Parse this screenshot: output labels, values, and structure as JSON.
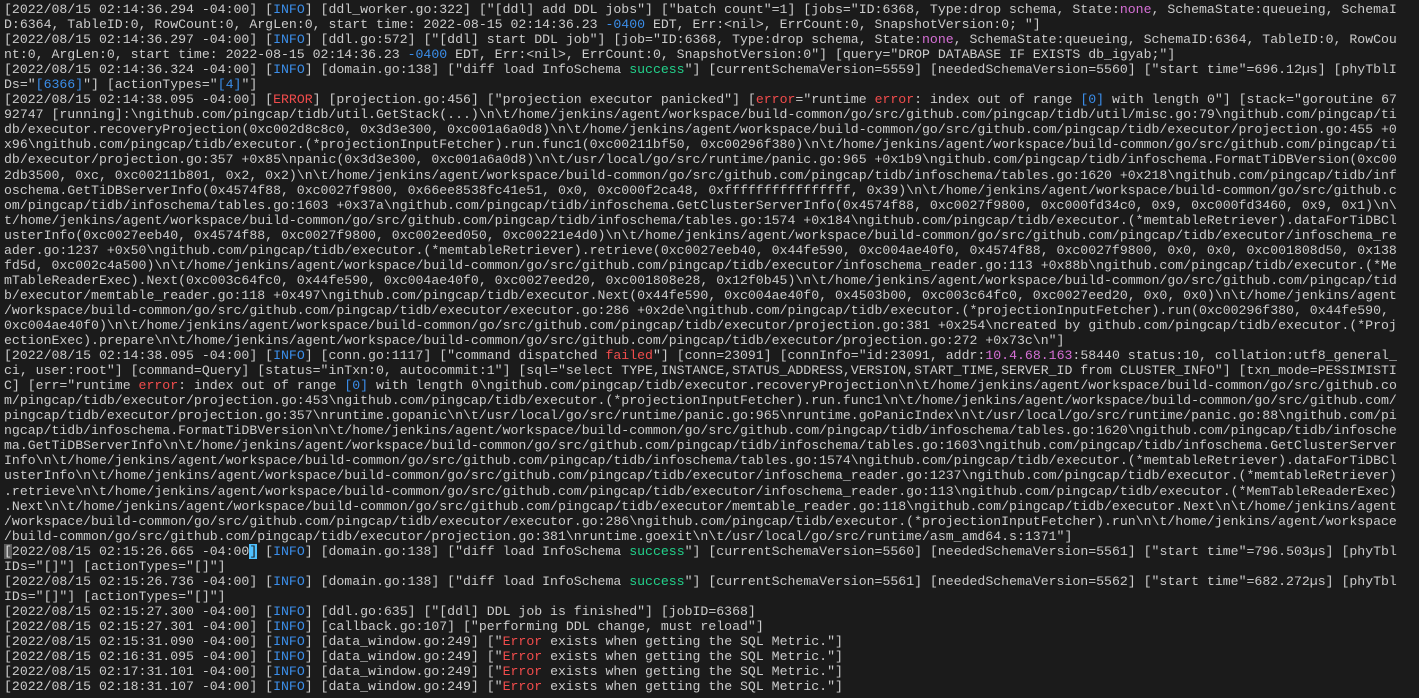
{
  "colors": {
    "default": "#cccccc",
    "info": "#3b8eea",
    "red": "#f14c4c",
    "mag": "#d670d6",
    "green": "#23d18b",
    "background": "#1b1b1b"
  },
  "lines": [
    [
      "[2022/08/15 02:14:36.294 -04:00] [",
      {
        "t": "INFO",
        "c": "info"
      },
      "] [ddl_worker.go:322] [\"[ddl] add DDL jobs\"] [\"batch count\"=1] [jobs=\"ID:6368, Type:drop schema, State:",
      {
        "t": "none",
        "c": "mag"
      },
      ", SchemaState:queueing, SchemaI"
    ],
    [
      "D:6364, TableID:0, RowCount:0, ArgLen:0, start time: 2022-08-15 02:14:36.23 ",
      {
        "t": "-0400",
        "c": "info"
      },
      " EDT, Err:<nil>, ErrCount:0, SnapshotVersion:0; \"]"
    ],
    [
      "[2022/08/15 02:14:36.297 -04:00] [",
      {
        "t": "INFO",
        "c": "info"
      },
      "] [ddl.go:572] [\"[ddl] start DDL job\"] [job=\"ID:6368, Type:drop schema, State:",
      {
        "t": "none",
        "c": "mag"
      },
      ", SchemaState:queueing, SchemaID:6364, TableID:0, RowCou"
    ],
    [
      "nt:0, ArgLen:0, start time: 2022-08-15 02:14:36.23 ",
      {
        "t": "-0400",
        "c": "info"
      },
      " EDT, Err:<nil>, ErrCount:0, SnapshotVersion:0\"] [query=\"DROP DATABASE IF EXISTS db_igyab;\"]"
    ],
    [
      "[2022/08/15 02:14:36.324 -04:00] [",
      {
        "t": "INFO",
        "c": "info"
      },
      "] [domain.go:138] [\"diff load InfoSchema ",
      {
        "t": "success",
        "c": "green"
      },
      "\"] [currentSchemaVersion=5559] [neededSchemaVersion=5560] [\"start time\"=696.12µs] [phyTblI"
    ],
    [
      "Ds=\"",
      {
        "t": "[6366]",
        "c": "info"
      },
      "\"] [actionTypes=\"",
      {
        "t": "[4]",
        "c": "info"
      },
      "\"]"
    ],
    [
      "[2022/08/15 02:14:38.095 -04:00] [",
      {
        "t": "ERROR",
        "c": "red"
      },
      "] [projection.go:456] [\"projection executor panicked\"] [",
      {
        "t": "error",
        "c": "red"
      },
      "=\"runtime ",
      {
        "t": "error",
        "c": "red"
      },
      ": index out of range ",
      {
        "t": "[0]",
        "c": "info"
      },
      " with length 0\"] [stack=\"goroutine 67"
    ],
    [
      "92747 [running]:\\ngithub.com/pingcap/tidb/util.GetStack(...)\\n\\t/home/jenkins/agent/workspace/build-common/go/src/github.com/pingcap/tidb/util/misc.go:79\\ngithub.com/pingcap/ti"
    ],
    [
      "db/executor.recoveryProjection(0xc002d8c8c0, 0x3d3e300, 0xc001a6a0d8)\\n\\t/home/jenkins/agent/workspace/build-common/go/src/github.com/pingcap/tidb/executor/projection.go:455 +0"
    ],
    [
      "x96\\ngithub.com/pingcap/tidb/executor.(*projectionInputFetcher).run.func1(0xc00211bf50, 0xc00296f380)\\n\\t/home/jenkins/agent/workspace/build-common/go/src/github.com/pingcap/ti"
    ],
    [
      "db/executor/projection.go:357 +0x85\\npanic(0x3d3e300, 0xc001a6a0d8)\\n\\t/usr/local/go/src/runtime/panic.go:965 +0x1b9\\ngithub.com/pingcap/tidb/infoschema.FormatTiDBVersion(0xc00"
    ],
    [
      "2db3500, 0xc, 0xc00211b801, 0x2, 0x2)\\n\\t/home/jenkins/agent/workspace/build-common/go/src/github.com/pingcap/tidb/infoschema/tables.go:1620 +0x218\\ngithub.com/pingcap/tidb/inf"
    ],
    [
      "oschema.GetTiDBServerInfo(0x4574f88, 0xc0027f9800, 0x66ee8538fc41e51, 0x0, 0xc000f2ca48, 0xffffffffffffffff, 0x39)\\n\\t/home/jenkins/agent/workspace/build-common/go/src/github.c"
    ],
    [
      "om/pingcap/tidb/infoschema/tables.go:1603 +0x37a\\ngithub.com/pingcap/tidb/infoschema.GetClusterServerInfo(0x4574f88, 0xc0027f9800, 0xc000fd34c0, 0x9, 0xc000fd3460, 0x9, 0x1)\\n\\"
    ],
    [
      "t/home/jenkins/agent/workspace/build-common/go/src/github.com/pingcap/tidb/infoschema/tables.go:1574 +0x184\\ngithub.com/pingcap/tidb/executor.(*memtableRetriever).dataForTiDBCl"
    ],
    [
      "usterInfo(0xc0027eeb40, 0x4574f88, 0xc0027f9800, 0xc002eed050, 0xc00221e4d0)\\n\\t/home/jenkins/agent/workspace/build-common/go/src/github.com/pingcap/tidb/executor/infoschema_re"
    ],
    [
      "ader.go:1237 +0x50\\ngithub.com/pingcap/tidb/executor.(*memtableRetriever).retrieve(0xc0027eeb40, 0x44fe590, 0xc004ae40f0, 0x4574f88, 0xc0027f9800, 0x0, 0x0, 0xc001808d50, 0x138"
    ],
    [
      "fd5d, 0xc002c4a500)\\n\\t/home/jenkins/agent/workspace/build-common/go/src/github.com/pingcap/tidb/executor/infoschema_reader.go:113 +0x88b\\ngithub.com/pingcap/tidb/executor.(*Me"
    ],
    [
      "mTableReaderExec).Next(0xc003c64fc0, 0x44fe590, 0xc004ae40f0, 0xc0027eed20, 0xc001808e28, 0x12f0b45)\\n\\t/home/jenkins/agent/workspace/build-common/go/src/github.com/pingcap/tid"
    ],
    [
      "b/executor/memtable_reader.go:118 +0x497\\ngithub.com/pingcap/tidb/executor.Next(0x44fe590, 0xc004ae40f0, 0x4503b00, 0xc003c64fc0, 0xc0027eed20, 0x0, 0x0)\\n\\t/home/jenkins/agent"
    ],
    [
      "/workspace/build-common/go/src/github.com/pingcap/tidb/executor/executor.go:286 +0x2de\\ngithub.com/pingcap/tidb/executor.(*projectionInputFetcher).run(0xc00296f380, 0x44fe590,"
    ],
    [
      "0xc004ae40f0)\\n\\t/home/jenkins/agent/workspace/build-common/go/src/github.com/pingcap/tidb/executor/projection.go:381 +0x254\\ncreated by github.com/pingcap/tidb/executor.(*Proj"
    ],
    [
      "ectionExec).prepare\\n\\t/home/jenkins/agent/workspace/build-common/go/src/github.com/pingcap/tidb/executor/projection.go:272 +0x73c\\n\"]"
    ],
    [
      "[2022/08/15 02:14:38.095 -04:00] [",
      {
        "t": "INFO",
        "c": "info"
      },
      "] [conn.go:1117] [\"command dispatched ",
      {
        "t": "failed",
        "c": "red"
      },
      "\"] [conn=23091] [connInfo=\"id:23091, addr:",
      {
        "t": "10.4.68.163",
        "c": "mag"
      },
      ":58440 status:10, collation:utf8_general_"
    ],
    [
      "ci, user:root\"] [command=Query] [status=\"inTxn:0, autocommit:1\"] [sql=\"select TYPE,INSTANCE,STATUS_ADDRESS,VERSION,START_TIME,SERVER_ID from CLUSTER_INFO\"] [txn_mode=PESSIMISTI"
    ],
    [
      "C] [err=\"runtime ",
      {
        "t": "error",
        "c": "red"
      },
      ": index out of range ",
      {
        "t": "[0]",
        "c": "info"
      },
      " with length 0\\ngithub.com/pingcap/tidb/executor.recoveryProjection\\n\\t/home/jenkins/agent/workspace/build-common/go/src/github.co"
    ],
    [
      "m/pingcap/tidb/executor/projection.go:453\\ngithub.com/pingcap/tidb/executor.(*projectionInputFetcher).run.func1\\n\\t/home/jenkins/agent/workspace/build-common/go/src/github.com/"
    ],
    [
      "pingcap/tidb/executor/projection.go:357\\nruntime.gopanic\\n\\t/usr/local/go/src/runtime/panic.go:965\\nruntime.goPanicIndex\\n\\t/usr/local/go/src/runtime/panic.go:88\\ngithub.com/pi"
    ],
    [
      "ngcap/tidb/infoschema.FormatTiDBVersion\\n\\t/home/jenkins/agent/workspace/build-common/go/src/github.com/pingcap/tidb/infoschema/tables.go:1620\\ngithub.com/pingcap/tidb/infosche"
    ],
    [
      "ma.GetTiDBServerInfo\\n\\t/home/jenkins/agent/workspace/build-common/go/src/github.com/pingcap/tidb/infoschema/tables.go:1603\\ngithub.com/pingcap/tidb/infoschema.GetClusterServer"
    ],
    [
      "Info\\n\\t/home/jenkins/agent/workspace/build-common/go/src/github.com/pingcap/tidb/infoschema/tables.go:1574\\ngithub.com/pingcap/tidb/executor.(*memtableRetriever).dataForTiDBCl"
    ],
    [
      "usterInfo\\n\\t/home/jenkins/agent/workspace/build-common/go/src/github.com/pingcap/tidb/executor/infoschema_reader.go:1237\\ngithub.com/pingcap/tidb/executor.(*memtableRetriever)"
    ],
    [
      ".retrieve\\n\\t/home/jenkins/agent/workspace/build-common/go/src/github.com/pingcap/tidb/executor/infoschema_reader.go:113\\ngithub.com/pingcap/tidb/executor.(*MemTableReaderExec)"
    ],
    [
      ".Next\\n\\t/home/jenkins/agent/workspace/build-common/go/src/github.com/pingcap/tidb/executor/memtable_reader.go:118\\ngithub.com/pingcap/tidb/executor.Next\\n\\t/home/jenkins/agent"
    ],
    [
      "/workspace/build-common/go/src/github.com/pingcap/tidb/executor/executor.go:286\\ngithub.com/pingcap/tidb/executor.(*projectionInputFetcher).run\\n\\t/home/jenkins/agent/workspace"
    ],
    [
      "/build-common/go/src/github.com/pingcap/tidb/executor/projection.go:381\\nruntime.goexit\\n\\t/usr/local/go/src/runtime/asm_amd64.s:1371\"]"
    ],
    [
      {
        "t": "[",
        "c": "sel"
      },
      "2022/08/15 02:15:26.665 -04:00",
      {
        "t": "]",
        "c": "cursor"
      },
      " [",
      {
        "t": "INFO",
        "c": "info"
      },
      "] [domain.go:138] [\"diff load InfoSchema ",
      {
        "t": "success",
        "c": "green"
      },
      "\"] [currentSchemaVersion=5560] [neededSchemaVersion=5561] [\"start time\"=796.503µs] [phyTbl"
    ],
    [
      "IDs=\"[]\"] [actionTypes=\"[]\"]"
    ],
    [
      "[2022/08/15 02:15:26.736 -04:00] [",
      {
        "t": "INFO",
        "c": "info"
      },
      "] [domain.go:138] [\"diff load InfoSchema ",
      {
        "t": "success",
        "c": "green"
      },
      "\"] [currentSchemaVersion=5561] [neededSchemaVersion=5562] [\"start time\"=682.272µs] [phyTbl"
    ],
    [
      "IDs=\"[]\"] [actionTypes=\"[]\"]"
    ],
    [
      "[2022/08/15 02:15:27.300 -04:00] [",
      {
        "t": "INFO",
        "c": "info"
      },
      "] [ddl.go:635] [\"[ddl] DDL job is finished\"] [jobID=6368]"
    ],
    [
      "[2022/08/15 02:15:27.301 -04:00] [",
      {
        "t": "INFO",
        "c": "info"
      },
      "] [callback.go:107] [\"performing DDL change, must reload\"]"
    ],
    [
      "[2022/08/15 02:15:31.090 -04:00] [",
      {
        "t": "INFO",
        "c": "info"
      },
      "] [data_window.go:249] [\"",
      {
        "t": "Error",
        "c": "red"
      },
      " exists when getting the SQL Metric.\"]"
    ],
    [
      "[2022/08/15 02:16:31.095 -04:00] [",
      {
        "t": "INFO",
        "c": "info"
      },
      "] [data_window.go:249] [\"",
      {
        "t": "Error",
        "c": "red"
      },
      " exists when getting the SQL Metric.\"]"
    ],
    [
      "[2022/08/15 02:17:31.101 -04:00] [",
      {
        "t": "INFO",
        "c": "info"
      },
      "] [data_window.go:249] [\"",
      {
        "t": "Error",
        "c": "red"
      },
      " exists when getting the SQL Metric.\"]"
    ],
    [
      "[2022/08/15 02:18:31.107 -04:00] [",
      {
        "t": "INFO",
        "c": "info"
      },
      "] [data_window.go:249] [\"",
      {
        "t": "Error",
        "c": "red"
      },
      " exists when getting the SQL Metric.\"]"
    ]
  ]
}
